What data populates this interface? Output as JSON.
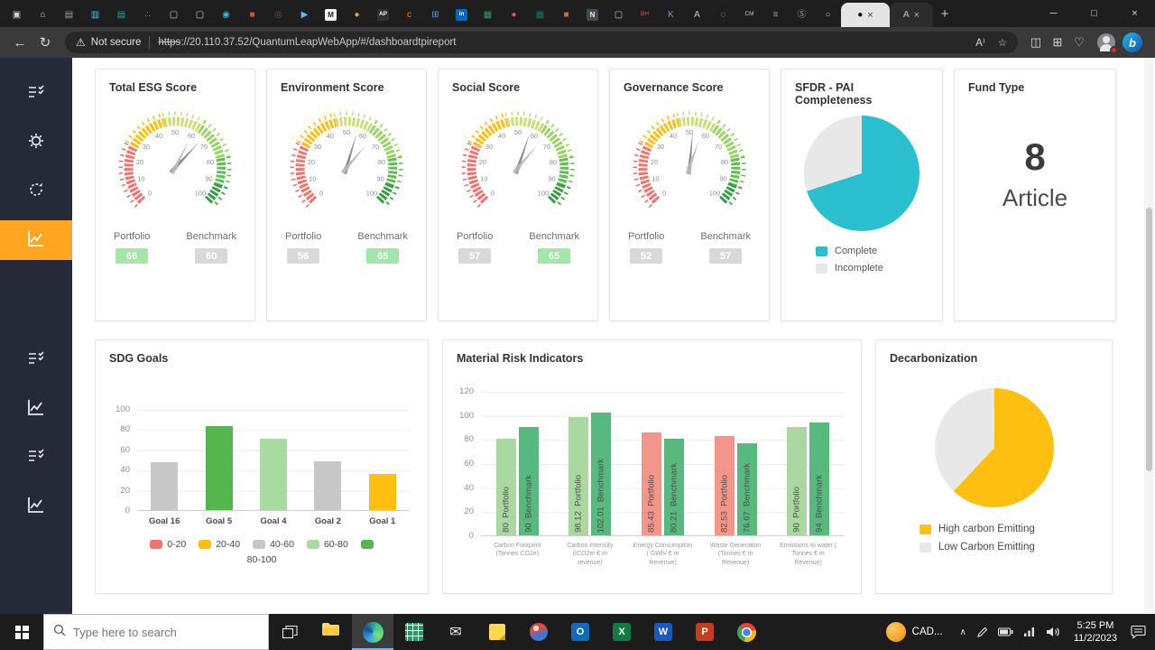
{
  "browser": {
    "tabs": [
      {
        "glyph": "▣",
        "color": "#cfd2d6"
      },
      {
        "glyph": "⌂",
        "color": "#cfd2d6"
      },
      {
        "glyph": "▤",
        "color": "#9aa0a6"
      },
      {
        "glyph": "▥",
        "color": "#4fc3f7"
      },
      {
        "glyph": "▤",
        "color": "#26a69a"
      },
      {
        "glyph": "∴",
        "color": "#5e97f6"
      },
      {
        "glyph": "▢",
        "color": "#c4c7cb"
      },
      {
        "glyph": "▢",
        "color": "#c4c7cb"
      },
      {
        "glyph": "◉",
        "color": "#26c6da"
      },
      {
        "glyph": "■",
        "color": "#d35230"
      },
      {
        "glyph": "◎",
        "color": "#a33c32"
      },
      {
        "glyph": "▶",
        "color": "#64b5f6"
      },
      {
        "glyph": "M",
        "color": "#222222",
        "bg": "#f5f5f5"
      },
      {
        "glyph": "●",
        "color": "#f0a030"
      },
      {
        "glyph": "AP",
        "color": "#f5f5f5",
        "bg": "#303030"
      },
      {
        "glyph": "c",
        "color": "#ef7d1a"
      },
      {
        "glyph": "⊞",
        "color": "#4f9df7"
      },
      {
        "glyph": "in",
        "color": "#ffffff",
        "bg": "#0a66c2"
      },
      {
        "glyph": "▦",
        "color": "#2e9e5b"
      },
      {
        "glyph": "●",
        "color": "#e05a4e"
      },
      {
        "glyph": "▦",
        "color": "#0b7a6c"
      },
      {
        "glyph": "■",
        "color": "#e0622f"
      },
      {
        "glyph": "N",
        "color": "#e8e8e8",
        "bg": "#444a52"
      },
      {
        "glyph": "▢",
        "color": "#c4c7cb"
      },
      {
        "glyph": "BH",
        "color": "#e05a4e"
      },
      {
        "glyph": "K",
        "color": "#5e97f6"
      },
      {
        "glyph": "A",
        "color": "#c4c7cb"
      },
      {
        "glyph": "◌",
        "color": "#c4c7cb"
      },
      {
        "glyph": "CM",
        "color": "#c4c7cb"
      },
      {
        "glyph": "≡",
        "color": "#9aa0a6"
      },
      {
        "glyph": "Ⓢ",
        "color": "#9aa0a6"
      },
      {
        "glyph": "○",
        "color": "#7fd4e8"
      }
    ],
    "active_tab": {
      "glyph": "●",
      "color": "#5f6368",
      "close": "×"
    },
    "second_tab": {
      "glyph": "A",
      "close": "×"
    },
    "new_tab_label": "+",
    "window_controls": {
      "minimize": "─",
      "maximize": "□",
      "close": "×"
    },
    "toolbar": {
      "back_icon": "←",
      "refresh_icon": "↻",
      "warning_icon": "⚠",
      "security_warning": "Not secure",
      "scheme": "https",
      "url_rest": "://20.110.37.52/QuantumLeapWebApp/#/dashboardtpireport",
      "read_aloud_icon": "A⁾",
      "favorite_icon": "☆",
      "split_icon": "◫",
      "collections_icon": "⊞",
      "essentials_icon": "♡",
      "bing_label": "b"
    }
  },
  "fund_type": {
    "title": "Fund Type",
    "value": "8",
    "label": "Article"
  },
  "taskbar": {
    "search_placeholder": "Type here to search",
    "widget_label": "CAD...",
    "hidden_icons_chevron": "∧",
    "clock": {
      "time": "5:25 PM",
      "date": "11/2/2023"
    },
    "app_glyphs": {
      "outlook": "O",
      "excel": "X",
      "word": "W",
      "powerpoint": "P"
    }
  },
  "chart_data": [
    {
      "id": "gauge-total-esg",
      "type": "gauge",
      "title": "Total ESG Score",
      "min": 0,
      "max": 100,
      "segments": [
        {
          "to": 27,
          "color": "#f4716d"
        },
        {
          "to": 45,
          "color": "#fdc010"
        },
        {
          "to": 62,
          "color": "#cde077"
        },
        {
          "to": 79,
          "color": "#97d564"
        },
        {
          "to": 91,
          "color": "#5fbf50"
        },
        {
          "to": 100,
          "color": "#339e42"
        }
      ],
      "kpis": [
        {
          "label": "Portfolio",
          "value": 66,
          "state": "good"
        },
        {
          "label": "Benchmark",
          "value": 60,
          "state": "neutral"
        }
      ]
    },
    {
      "id": "gauge-environment",
      "type": "gauge",
      "title": "Environment Score",
      "min": 0,
      "max": 100,
      "segments": [
        {
          "to": 27,
          "color": "#f4716d"
        },
        {
          "to": 45,
          "color": "#fdc010"
        },
        {
          "to": 62,
          "color": "#cde077"
        },
        {
          "to": 79,
          "color": "#97d564"
        },
        {
          "to": 91,
          "color": "#5fbf50"
        },
        {
          "to": 100,
          "color": "#339e42"
        }
      ],
      "kpis": [
        {
          "label": "Portfolio",
          "value": 56,
          "state": "neutral"
        },
        {
          "label": "Benchmark",
          "value": 65,
          "state": "good"
        }
      ]
    },
    {
      "id": "gauge-social",
      "type": "gauge",
      "title": "Social Score",
      "min": 0,
      "max": 100,
      "segments": [
        {
          "to": 27,
          "color": "#f4716d"
        },
        {
          "to": 45,
          "color": "#fdc010"
        },
        {
          "to": 62,
          "color": "#cde077"
        },
        {
          "to": 79,
          "color": "#97d564"
        },
        {
          "to": 91,
          "color": "#5fbf50"
        },
        {
          "to": 100,
          "color": "#339e42"
        }
      ],
      "kpis": [
        {
          "label": "Portfolio",
          "value": 57,
          "state": "neutral"
        },
        {
          "label": "Benchmark",
          "value": 65,
          "state": "good"
        }
      ]
    },
    {
      "id": "gauge-governance",
      "type": "gauge",
      "title": "Governance Score",
      "min": 0,
      "max": 100,
      "segments": [
        {
          "to": 27,
          "color": "#f4716d"
        },
        {
          "to": 45,
          "color": "#fdc010"
        },
        {
          "to": 62,
          "color": "#cde077"
        },
        {
          "to": 79,
          "color": "#97d564"
        },
        {
          "to": 91,
          "color": "#5fbf50"
        },
        {
          "to": 100,
          "color": "#339e42"
        }
      ],
      "kpis": [
        {
          "label": "Portfolio",
          "value": 52,
          "state": "neutral"
        },
        {
          "label": "Benchmark",
          "value": 57,
          "state": "neutral"
        }
      ]
    },
    {
      "id": "pie-sfdr",
      "type": "pie",
      "title": "SFDR - PAI Completeness",
      "size": 128,
      "slices": [
        {
          "label": "Complete",
          "value": 70,
          "color": "#29bfce"
        },
        {
          "label": "Incomplete",
          "value": 30,
          "color": "#e8e8e8"
        }
      ]
    },
    {
      "id": "bar-sdg",
      "type": "bar",
      "title": "SDG Goals",
      "ylim": [
        0,
        100
      ],
      "yticks": [
        0,
        20,
        40,
        60,
        80,
        100
      ],
      "categories": [
        "Goal 16",
        "Goal 5",
        "Goal 4",
        "Goal 2",
        "Goal 1"
      ],
      "values": [
        47,
        83,
        71,
        48,
        36
      ],
      "colors": [
        "#c7c7c7",
        "#53b64e",
        "#a8dba0",
        "#c7c7c7",
        "#fdc010"
      ],
      "legend": [
        {
          "label": "0-20",
          "color": "#f4716d"
        },
        {
          "label": "20-40",
          "color": "#fdc010"
        },
        {
          "label": "40-60",
          "color": "#c7c7c7"
        },
        {
          "label": "60-80",
          "color": "#a8dba0"
        },
        {
          "label": "80-100",
          "color": "#53b64e"
        }
      ]
    },
    {
      "id": "bar-material",
      "type": "grouped-bar",
      "title": "Material Risk Indicators",
      "ylim": [
        0,
        120
      ],
      "yticks": [
        0,
        20,
        40,
        60,
        80,
        100,
        120
      ],
      "categories": [
        "Carbon Footprint (Tonnes CO2e)",
        "Carbon Intensity (tCO2e/ € m revenue)",
        "Energy Consumption ( GWh/ € m Revenue)",
        "Waste Generation (Tonnes € m Revenue)",
        "Emissions to water ( Tonnes € m Revenue)"
      ],
      "series": [
        {
          "name": "Portfolio",
          "values": [
            80,
            98.12,
            85.43,
            82.53,
            90
          ],
          "colors": [
            "#aad8a0",
            "#aad8a0",
            "#f2968c",
            "#f2968c",
            "#aad8a0"
          ]
        },
        {
          "name": "Benchmark",
          "values": [
            90,
            102.01,
            80.21,
            76.67,
            94
          ],
          "colors": [
            "#57b97e",
            "#57b97e",
            "#57b97e",
            "#57b97e",
            "#57b97e"
          ]
        }
      ]
    },
    {
      "id": "pie-decarb",
      "type": "pie",
      "title": "Decarbonization",
      "size": 132,
      "slices": [
        {
          "label": "High carbon Emitting",
          "value": 62,
          "color": "#fdc010"
        },
        {
          "label": "Low Carbon Emitting",
          "value": 38,
          "color": "#e8e8e8"
        }
      ]
    }
  ]
}
